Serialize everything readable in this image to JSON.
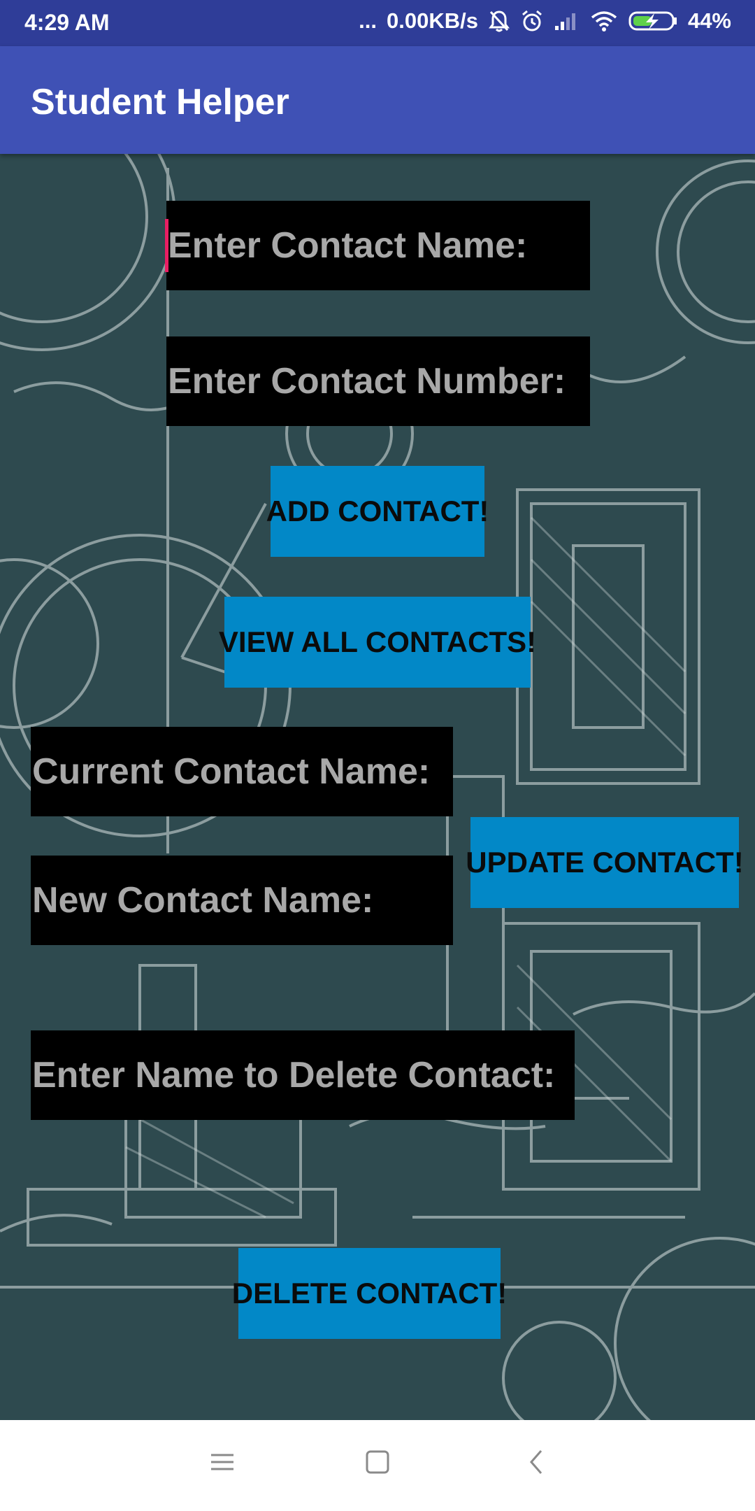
{
  "status_bar": {
    "time": "4:29 AM",
    "more": "...",
    "network_speed": "0.00KB/s",
    "battery": "44%",
    "icons": [
      "bell-off-icon",
      "alarm-icon",
      "signal-icon",
      "wifi-icon",
      "battery-charging-icon"
    ]
  },
  "app_bar": {
    "title": "Student Helper"
  },
  "form": {
    "contact_name_placeholder": "Enter Contact Name:",
    "contact_number_placeholder": "Enter Contact Number:",
    "add_button": "ADD CONTACT!",
    "view_all_button": "VIEW ALL CONTACTS!",
    "current_name_placeholder": "Current Contact Name:",
    "new_name_placeholder": "New Contact Name:",
    "update_button": "UPDATE CONTACT!",
    "delete_name_placeholder": "Enter Name to Delete Contact:",
    "delete_button": "DELETE CONTACT!"
  },
  "nav_bar": {
    "icons": [
      "menu-icon",
      "home-square-icon",
      "back-chevron-icon"
    ]
  },
  "colors": {
    "status_bar": "#2f3d98",
    "app_bar": "#3f51b5",
    "button": "#0288c7",
    "field": "#000000",
    "placeholder": "#a8a8a8",
    "cursor": "#e91e63",
    "background": "#2e4a4f"
  }
}
